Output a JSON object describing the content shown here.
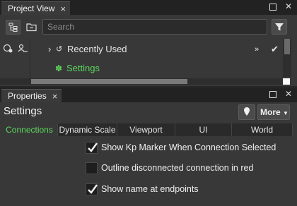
{
  "project_view": {
    "tab_label": "Project View",
    "tab_close": "×",
    "search_placeholder": "Search",
    "tree": {
      "recently_used": "Recently Used",
      "settings": "Settings"
    }
  },
  "properties": {
    "tab_label": "Properties",
    "tab_close": "×",
    "title": "Settings",
    "more_button": "More",
    "tabs": [
      "Connections",
      "Dynamic Scale",
      "Viewport",
      "UI",
      "World"
    ],
    "active_tab": "Connections",
    "checkboxes": [
      {
        "label": "Show Kp Marker When Connection Selected",
        "checked": true
      },
      {
        "label": "Outline disconnected connection in red",
        "checked": false
      },
      {
        "label": "Show name at endpoints",
        "checked": true
      }
    ]
  },
  "colors": {
    "accent_green": "#5dd85d",
    "background": "#383838"
  }
}
